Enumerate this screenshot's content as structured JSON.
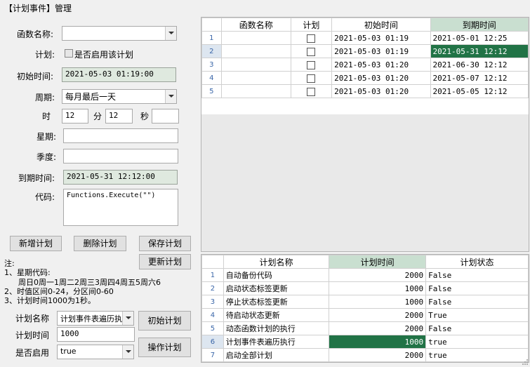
{
  "window": {
    "title": "【计划事件】管理"
  },
  "form": {
    "function_name_label": "函数名称:",
    "function_name_value": "",
    "plan_label": "计划:",
    "plan_checkbox_label": "是否启用该计划",
    "start_time_label": "初始时间:",
    "start_time_value": "2021-05-03 01:19:00",
    "period_label": "周期:",
    "period_value": "每月最后一天",
    "hour_label": "时",
    "hour_value": "12",
    "minute_label": "分",
    "minute_value": "12",
    "second_label": "秒",
    "second_value": "",
    "week_label": "星期:",
    "week_value": "",
    "quarter_label": "季度:",
    "quarter_value": "",
    "due_time_label": "到期时间:",
    "due_time_value": "2021-05-31 12:12:00",
    "code_label": "代码:",
    "code_value": "Functions.Execute(\"\")"
  },
  "buttons": {
    "add": "新增计划",
    "delete": "删除计划",
    "save": "保存计划",
    "update": "更新计划",
    "init": "初始计划",
    "operate": "操作计划"
  },
  "notes": {
    "title": "注:",
    "line1": "1、星期代码:",
    "line2": "周日0周一1周二2周三3周四4周五5周六6",
    "line3": "2、时值区间0-24，分区间0-60",
    "line4": "3、计划时间1000为1秒。"
  },
  "bottom_form": {
    "plan_name_label": "计划名称",
    "plan_name_value": "计划事件表遍历执",
    "plan_time_label": "计划时间",
    "plan_time_value": "1000",
    "enabled_label": "是否启用",
    "enabled_value": "true"
  },
  "top_grid": {
    "columns": [
      "函数名称",
      "计划",
      "初始时间",
      "到期时间"
    ],
    "rows": [
      {
        "n": "1",
        "name": "",
        "start": "2021-05-03 01:19",
        "due": "2021-05-01 12:25"
      },
      {
        "n": "2",
        "name": "",
        "start": "2021-05-03 01:19",
        "due": "2021-05-31 12:12"
      },
      {
        "n": "3",
        "name": "",
        "start": "2021-05-03 01:20",
        "due": "2021-06-30 12:12"
      },
      {
        "n": "4",
        "name": "",
        "start": "2021-05-03 01:20",
        "due": "2021-05-07 12:12"
      },
      {
        "n": "5",
        "name": "",
        "start": "2021-05-03 01:20",
        "due": "2021-05-05 12:12"
      }
    ]
  },
  "bottom_grid": {
    "columns": [
      "计划名称",
      "计划时间",
      "计划状态"
    ],
    "rows": [
      {
        "n": "1",
        "name": "自动备份代码",
        "time": "2000",
        "status": "False"
      },
      {
        "n": "2",
        "name": "启动状态标签更新",
        "time": "1000",
        "status": "False"
      },
      {
        "n": "3",
        "name": "停止状态标签更新",
        "time": "1000",
        "status": "False"
      },
      {
        "n": "4",
        "name": "待启动状态更新",
        "time": "2000",
        "status": "True"
      },
      {
        "n": "5",
        "name": "动态函数计划的执行",
        "time": "2000",
        "status": "False"
      },
      {
        "n": "6",
        "name": "计划事件表遍历执行",
        "time": "1000",
        "status": "true"
      },
      {
        "n": "7",
        "name": "启动全部计划",
        "time": "2000",
        "status": "true"
      }
    ]
  },
  "colors": {
    "selected_cell": "#217346",
    "readonly_field": "#dfe9df",
    "row_number": "#3a66a8"
  }
}
